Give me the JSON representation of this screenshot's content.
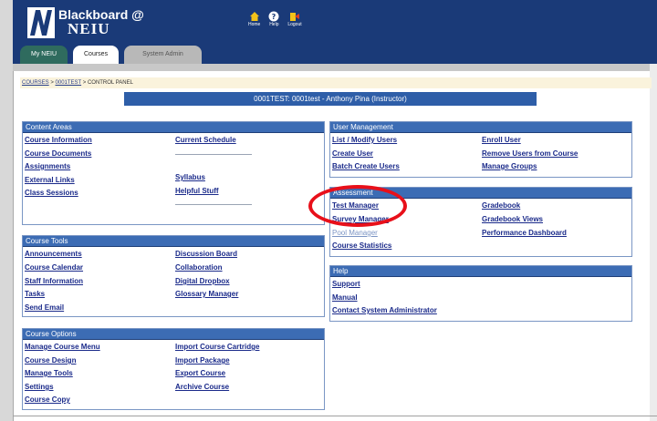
{
  "header": {
    "brand_line1": "Blackboard @",
    "brand_line2": "NEIU",
    "tools": [
      {
        "label": "Home",
        "icon": "home-icon"
      },
      {
        "label": "Help",
        "icon": "help-icon"
      },
      {
        "label": "Logout",
        "icon": "logout-icon"
      }
    ]
  },
  "tabs": [
    "My NEIU",
    "Courses",
    "System Admin"
  ],
  "breadcrumb": {
    "items": [
      "COURSES",
      "0001TEST",
      "CONTROL PANEL"
    ],
    "separator": " > "
  },
  "course_title": "0001TEST: 0001test - Anthony Pina (Instructor)",
  "content_areas": {
    "title": "Content Areas",
    "left": [
      "Course Information",
      "Course Documents",
      "Assignments",
      "External Links",
      "Class Sessions"
    ],
    "right": [
      "Current Schedule",
      "Syllabus",
      "Helpful Stuff"
    ]
  },
  "course_tools": {
    "title": "Course Tools",
    "left": [
      "Announcements",
      "Course Calendar",
      "Staff Information",
      "Tasks",
      "Send Email"
    ],
    "right": [
      "Discussion Board",
      "Collaboration",
      "Digital Dropbox",
      "Glossary Manager"
    ]
  },
  "course_options": {
    "title": "Course Options",
    "left": [
      "Manage Course Menu",
      "Course Design",
      "Manage Tools",
      "Settings",
      "Course Copy"
    ],
    "right": [
      "Import Course Cartridge",
      "Import Package",
      "Export Course",
      "Archive Course"
    ]
  },
  "user_management": {
    "title": "User Management",
    "left": [
      "List / Modify Users",
      "Create User",
      "Batch Create Users"
    ],
    "right": [
      "Enroll User",
      "Remove Users from Course",
      "Manage Groups"
    ]
  },
  "assessment": {
    "title": "Assessment",
    "left": [
      "Test Manager",
      "Survey Manager",
      "Pool Manager",
      "Course Statistics"
    ],
    "right": [
      "Gradebook",
      "Gradebook Views",
      "Performance Dashboard"
    ]
  },
  "help": {
    "title": "Help",
    "items": [
      "Support",
      "Manual",
      "Contact System Administrator"
    ]
  },
  "colors": {
    "header_bg": "#1a3a78",
    "panel_header": "#3c6cb4",
    "link": "#1a2a8a",
    "highlight": "#e8101a"
  }
}
